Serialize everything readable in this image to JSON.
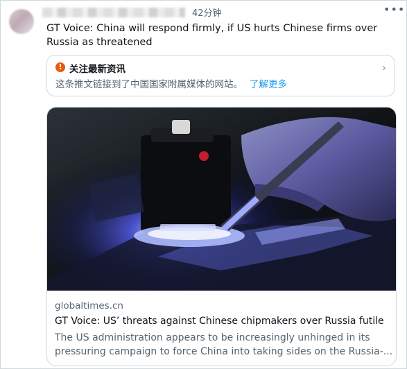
{
  "tweet": {
    "time": "42分钟",
    "more_icon": "more-dots-icon",
    "text": "GT Voice: China will respond firmly, if US hurts Chinese firms over Russia as threatened"
  },
  "notice": {
    "icon": "warning-icon",
    "icon_glyph": "!",
    "title": "关注最新资讯",
    "body": "这条推文链接到了中国国家附属媒体的网站。",
    "link": "了解更多",
    "chevron_icon": "chevron-right-icon",
    "chevron_glyph": "›"
  },
  "card": {
    "domain": "globaltimes.cn",
    "title": "GT Voice: US’ threats against Chinese chipmakers over Russia futile",
    "description_line1": "The US administration appears to be increasingly unhinged in its",
    "description_line2": "pressuring campaign to force China into taking sides on the Russia-..."
  },
  "colors": {
    "text_primary": "#0f1419",
    "text_secondary": "#536471",
    "link": "#1d9bf0",
    "warning": "#ea5a0c",
    "border": "#cfd9de"
  }
}
